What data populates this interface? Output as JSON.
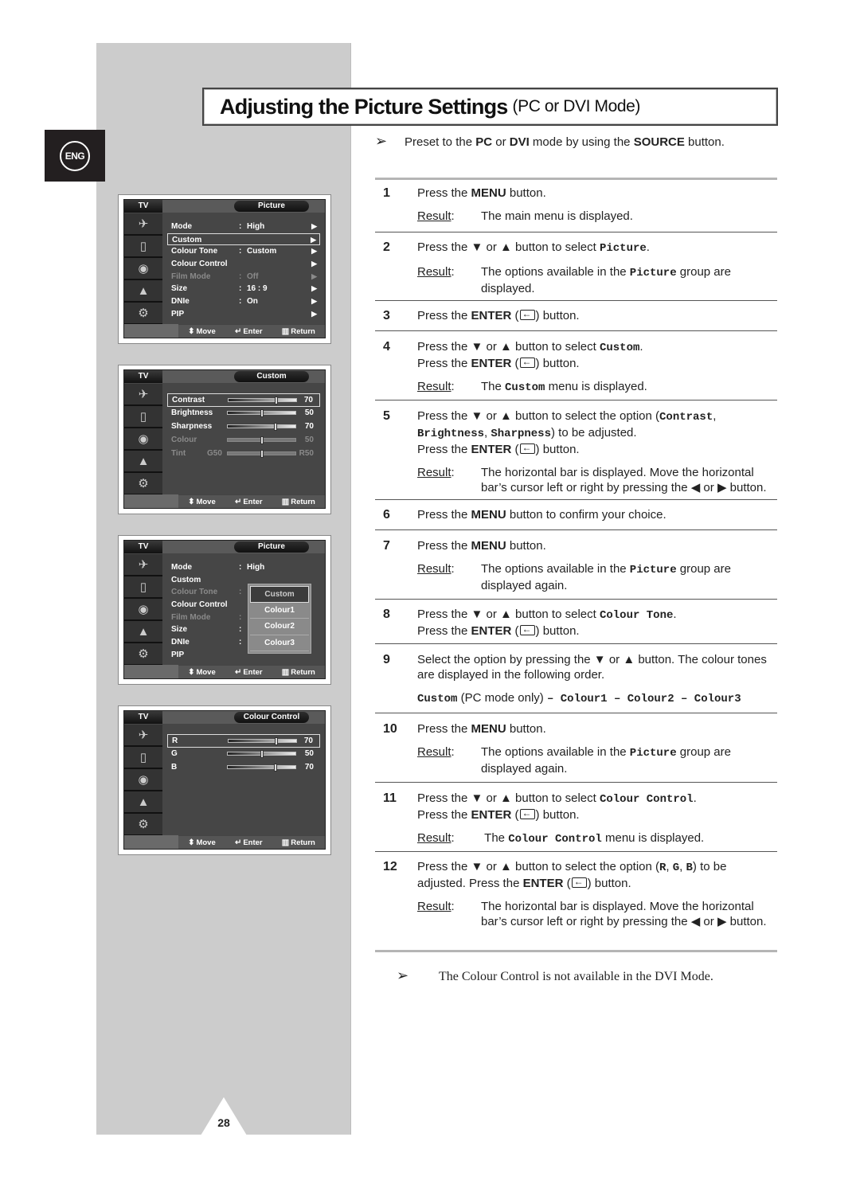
{
  "language_tab": "ENG",
  "page_number": "28",
  "title": {
    "main": "Adjusting the Picture Settings",
    "sub": "(PC or DVI Mode)"
  },
  "preset": {
    "pre": "Preset to the ",
    "pc": "PC",
    "or": " or ",
    "dvi": "DVI",
    "mid": " mode by using the ",
    "source": "SOURCE",
    "post": " button."
  },
  "result_label": "Result",
  "steps": [
    {
      "num": "1",
      "lines": [
        "Press the ",
        "MENU",
        " button."
      ],
      "result": "The main menu is displayed."
    },
    {
      "num": "2",
      "text": "Press the ▼ or ▲ button to select ",
      "code": "Picture",
      "result_pre": "The options available in the ",
      "result_code": "Picture",
      "result_post": " group are displayed."
    },
    {
      "num": "3",
      "pre": "Press the ",
      "bold": "ENTER",
      "post": " button."
    },
    {
      "num": "4",
      "text": "Press the ▼ or ▲ button to select ",
      "code": "Custom",
      "enter_pre": "Press the ",
      "enter_bold": "ENTER",
      "enter_post": " button.",
      "result_pre": "The ",
      "result_code": "Custom",
      "result_post": " menu is displayed."
    },
    {
      "num": "5",
      "text": "Press the ▼ or ▲ button to select the option (",
      "code1": "Contrast",
      "code2": "Brightness",
      "code3": "Sharpness",
      "post": ") to be adjusted.",
      "enter_pre": "Press the ",
      "enter_bold": "ENTER",
      "enter_post": " button.",
      "result": "The horizontal bar is displayed. Move the horizontal bar’s cursor left or right by pressing the ◀ or ▶ button."
    },
    {
      "num": "6",
      "pre": "Press the ",
      "bold": "MENU",
      "post": " button to confirm your choice."
    },
    {
      "num": "7",
      "pre": "Press the ",
      "bold": "MENU",
      "post": " button.",
      "result_pre": "The options available in the ",
      "result_code": "Picture",
      "result_post": " group are displayed again."
    },
    {
      "num": "8",
      "text": "Press the ▼ or ▲ button to select ",
      "code": "Colour Tone",
      "enter_pre": "Press the ",
      "enter_bold": "ENTER",
      "enter_post": " button."
    },
    {
      "num": "9",
      "text": "Select the option by pressing the ▼ or ▲ button. The colour tones are displayed in the following order.",
      "order_code1": "Custom",
      "order_text": " (PC mode only) ",
      "order_code2": " – Colour1 – Colour2 – Colour3"
    },
    {
      "num": "10",
      "pre": "Press the ",
      "bold": "MENU",
      "post": " button.",
      "result_pre": "The options available in the ",
      "result_code": "Picture",
      "result_post": " group are displayed again."
    },
    {
      "num": "11",
      "text": "Press the ▼ or ▲ button to select ",
      "code": "Colour Control",
      "enter_pre": "Press the ",
      "enter_bold": "ENTER",
      "enter_post": " button.",
      "result_pre": "The ",
      "result_code": "Colour Control",
      "result_post": " menu is displayed."
    },
    {
      "num": "12",
      "text": "Press the ▼ or ▲ button to select the option (",
      "r": "R",
      "g": "G",
      "b": "B",
      "post": ") to be adjusted. Press the ",
      "enter_bold": "ENTER",
      "enter_post": " button.",
      "result": "The horizontal bar is displayed. Move the horizontal bar’s cursor left or right by pressing the ◀ or ▶ button."
    }
  ],
  "note": "The Colour Control is not available in the DVI Mode.",
  "osd_common": {
    "tv": "TV",
    "move": "Move",
    "enter": "Enter",
    "return": "Return"
  },
  "osd1": {
    "title": "Picture",
    "rows": [
      {
        "label": "Mode",
        "value": "High",
        "state": "normal"
      },
      {
        "label": "Custom",
        "value": "",
        "state": "selected"
      },
      {
        "label": "Colour Tone",
        "value": "Custom",
        "state": "normal"
      },
      {
        "label": "Colour Control",
        "value": "",
        "state": "normal"
      },
      {
        "label": "Film Mode",
        "value": "Off",
        "state": "disabled"
      },
      {
        "label": "Size",
        "value": "16 : 9",
        "state": "normal"
      },
      {
        "label": "DNIe",
        "value": "On",
        "state": "normal"
      },
      {
        "label": "PIP",
        "value": "",
        "state": "normal"
      }
    ]
  },
  "osd2": {
    "title": "Custom",
    "rows": [
      {
        "label": "Contrast",
        "value": 70,
        "state": "selected"
      },
      {
        "label": "Brightness",
        "value": 50,
        "state": "normal"
      },
      {
        "label": "Sharpness",
        "value": 70,
        "state": "normal"
      },
      {
        "label": "Colour",
        "value": 50,
        "state": "disabled"
      },
      {
        "label": "Tint",
        "left": "G50",
        "right": "R50",
        "value": 50,
        "state": "disabled"
      }
    ]
  },
  "osd3": {
    "title": "Picture",
    "rows": [
      {
        "label": "Mode",
        "value": "High",
        "state": "normal"
      },
      {
        "label": "Custom",
        "state": "normal"
      },
      {
        "label": "Colour Tone",
        "state": "disabled"
      },
      {
        "label": "Colour Control",
        "state": "normal"
      },
      {
        "label": "Film Mode",
        "state": "disabled"
      },
      {
        "label": "Size",
        "state": "normal"
      },
      {
        "label": "DNIe",
        "state": "normal"
      },
      {
        "label": "PIP",
        "state": "normal"
      }
    ],
    "popup": [
      "Custom",
      "Colour1",
      "Colour2",
      "Colour3"
    ],
    "popup_selected": "Custom"
  },
  "osd4": {
    "title": "Colour Control",
    "rows": [
      {
        "label": "R",
        "value": 70,
        "state": "selected"
      },
      {
        "label": "G",
        "value": 50,
        "state": "normal"
      },
      {
        "label": "B",
        "value": 70,
        "state": "normal"
      }
    ]
  }
}
